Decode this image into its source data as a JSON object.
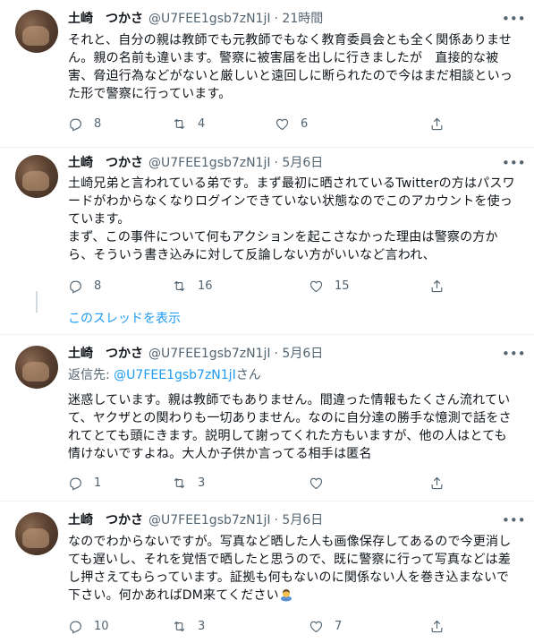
{
  "tweets": [
    {
      "name": "土崎　つかさ",
      "handle": "@U7FEE1gsb7zN1jI",
      "time": "· 21時間",
      "text": "それと、自分の親は教師でも元教師でもなく教育委員会とも全く関係ありません。親の名前も違います。警察に被害届を出しに行きましたが　直接的な被害、脅迫行為などがないと厳しいと遠回しに断られたので今はまだ相談といった形で警察に行っています。",
      "replies": "8",
      "retweets": "4",
      "likes": "6"
    },
    {
      "name": "土崎　つかさ",
      "handle": "@U7FEE1gsb7zN1jI",
      "time": "· 5月6日",
      "text": "土崎兄弟と言われている弟です。まず最初に晒されているTwitterの方はパスワードがわからなくなりログインできていない状態なのでこのアカウントを使っています。\nまず、この事件について何もアクションを起こさなかった理由は警察の方から、そういう書き込みに対して反論しない方がいいなど言われ、",
      "replies": "8",
      "retweets": "16",
      "likes": "15"
    },
    {
      "name": "土崎　つかさ",
      "handle": "@U7FEE1gsb7zN1jI",
      "time": "· 5月6日",
      "reply_prefix": "返信先: ",
      "reply_mention": "@U7FEE1gsb7zN1jI",
      "reply_suffix": "さん",
      "text": "迷惑しています。親は教師でもありません。間違った情報もたくさん流れていて、ヤクザとの関わりも一切ありません。なのに自分達の勝手な憶測で話をされてとても頭にきます。説明して謝ってくれた方もいますが、他の人はとても情けないですよね。大人か子供か言ってる相手は匿名",
      "replies": "1",
      "retweets": "3",
      "likes": ""
    },
    {
      "name": "土崎　つかさ",
      "handle": "@U7FEE1gsb7zN1jI",
      "time": "· 5月6日",
      "text": "なのでわからないですが。写真など晒した人も画像保存してあるので今更消しても遅いし、それを覚悟で晒したと思うので、既に警察に行って写真などは差し押さえてもらっています。証拠も何もないのに関係ない人を巻き込まないで下さい。何かあればDM来てください",
      "replies": "10",
      "retweets": "3",
      "likes": "7"
    }
  ],
  "show_thread": "このスレッドを表示",
  "icons": {
    "reply": "reply-icon",
    "retweet": "retweet-icon",
    "like": "like-icon",
    "share": "share-icon",
    "more": "more-icon",
    "emoji": "person-bowing-emoji"
  },
  "colors": {
    "accent": "#1d9bf0",
    "secondary": "#536471",
    "separator": "#eff3f4",
    "thread_line": "#cfd9de"
  }
}
